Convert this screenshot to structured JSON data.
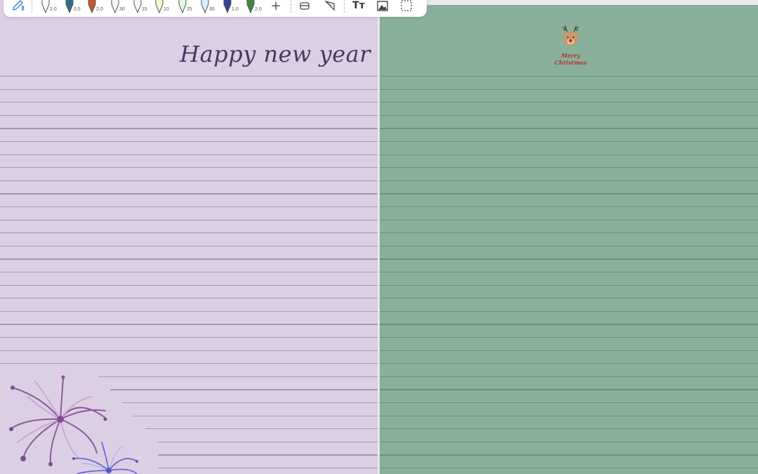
{
  "toolbar": {
    "pens": [
      {
        "name": "pen-1",
        "size": "2.0",
        "color": "#ffffff"
      },
      {
        "name": "pen-2",
        "size": "0.5",
        "color": "#2c6e8a"
      },
      {
        "name": "pen-3",
        "size": "2.0",
        "color": "#c8572d"
      },
      {
        "name": "pen-4",
        "size": "30",
        "color": "#f7f7f7"
      },
      {
        "name": "pen-5",
        "size": "15",
        "color": "#f7f7f7"
      },
      {
        "name": "pen-6",
        "size": "10",
        "color": "#f7f7d0"
      },
      {
        "name": "pen-7",
        "size": "25",
        "color": "#dff7e0"
      },
      {
        "name": "pen-8",
        "size": "30",
        "color": "#dbeef7"
      },
      {
        "name": "pen-9",
        "size": "1.0",
        "color": "#3a3f9a"
      },
      {
        "name": "pen-10",
        "size": "2.0",
        "color": "#3e8a3e"
      }
    ],
    "add_label": "+",
    "text_tool_label": "Tт"
  },
  "left_page": {
    "heading": "Happy new year",
    "background": "#dccfe3",
    "line_color": "#a59aa9"
  },
  "right_page": {
    "sticker_line1": "Merry",
    "sticker_line2": "Christmas",
    "background": "#89b09a",
    "line_color": "#6f8f76"
  }
}
